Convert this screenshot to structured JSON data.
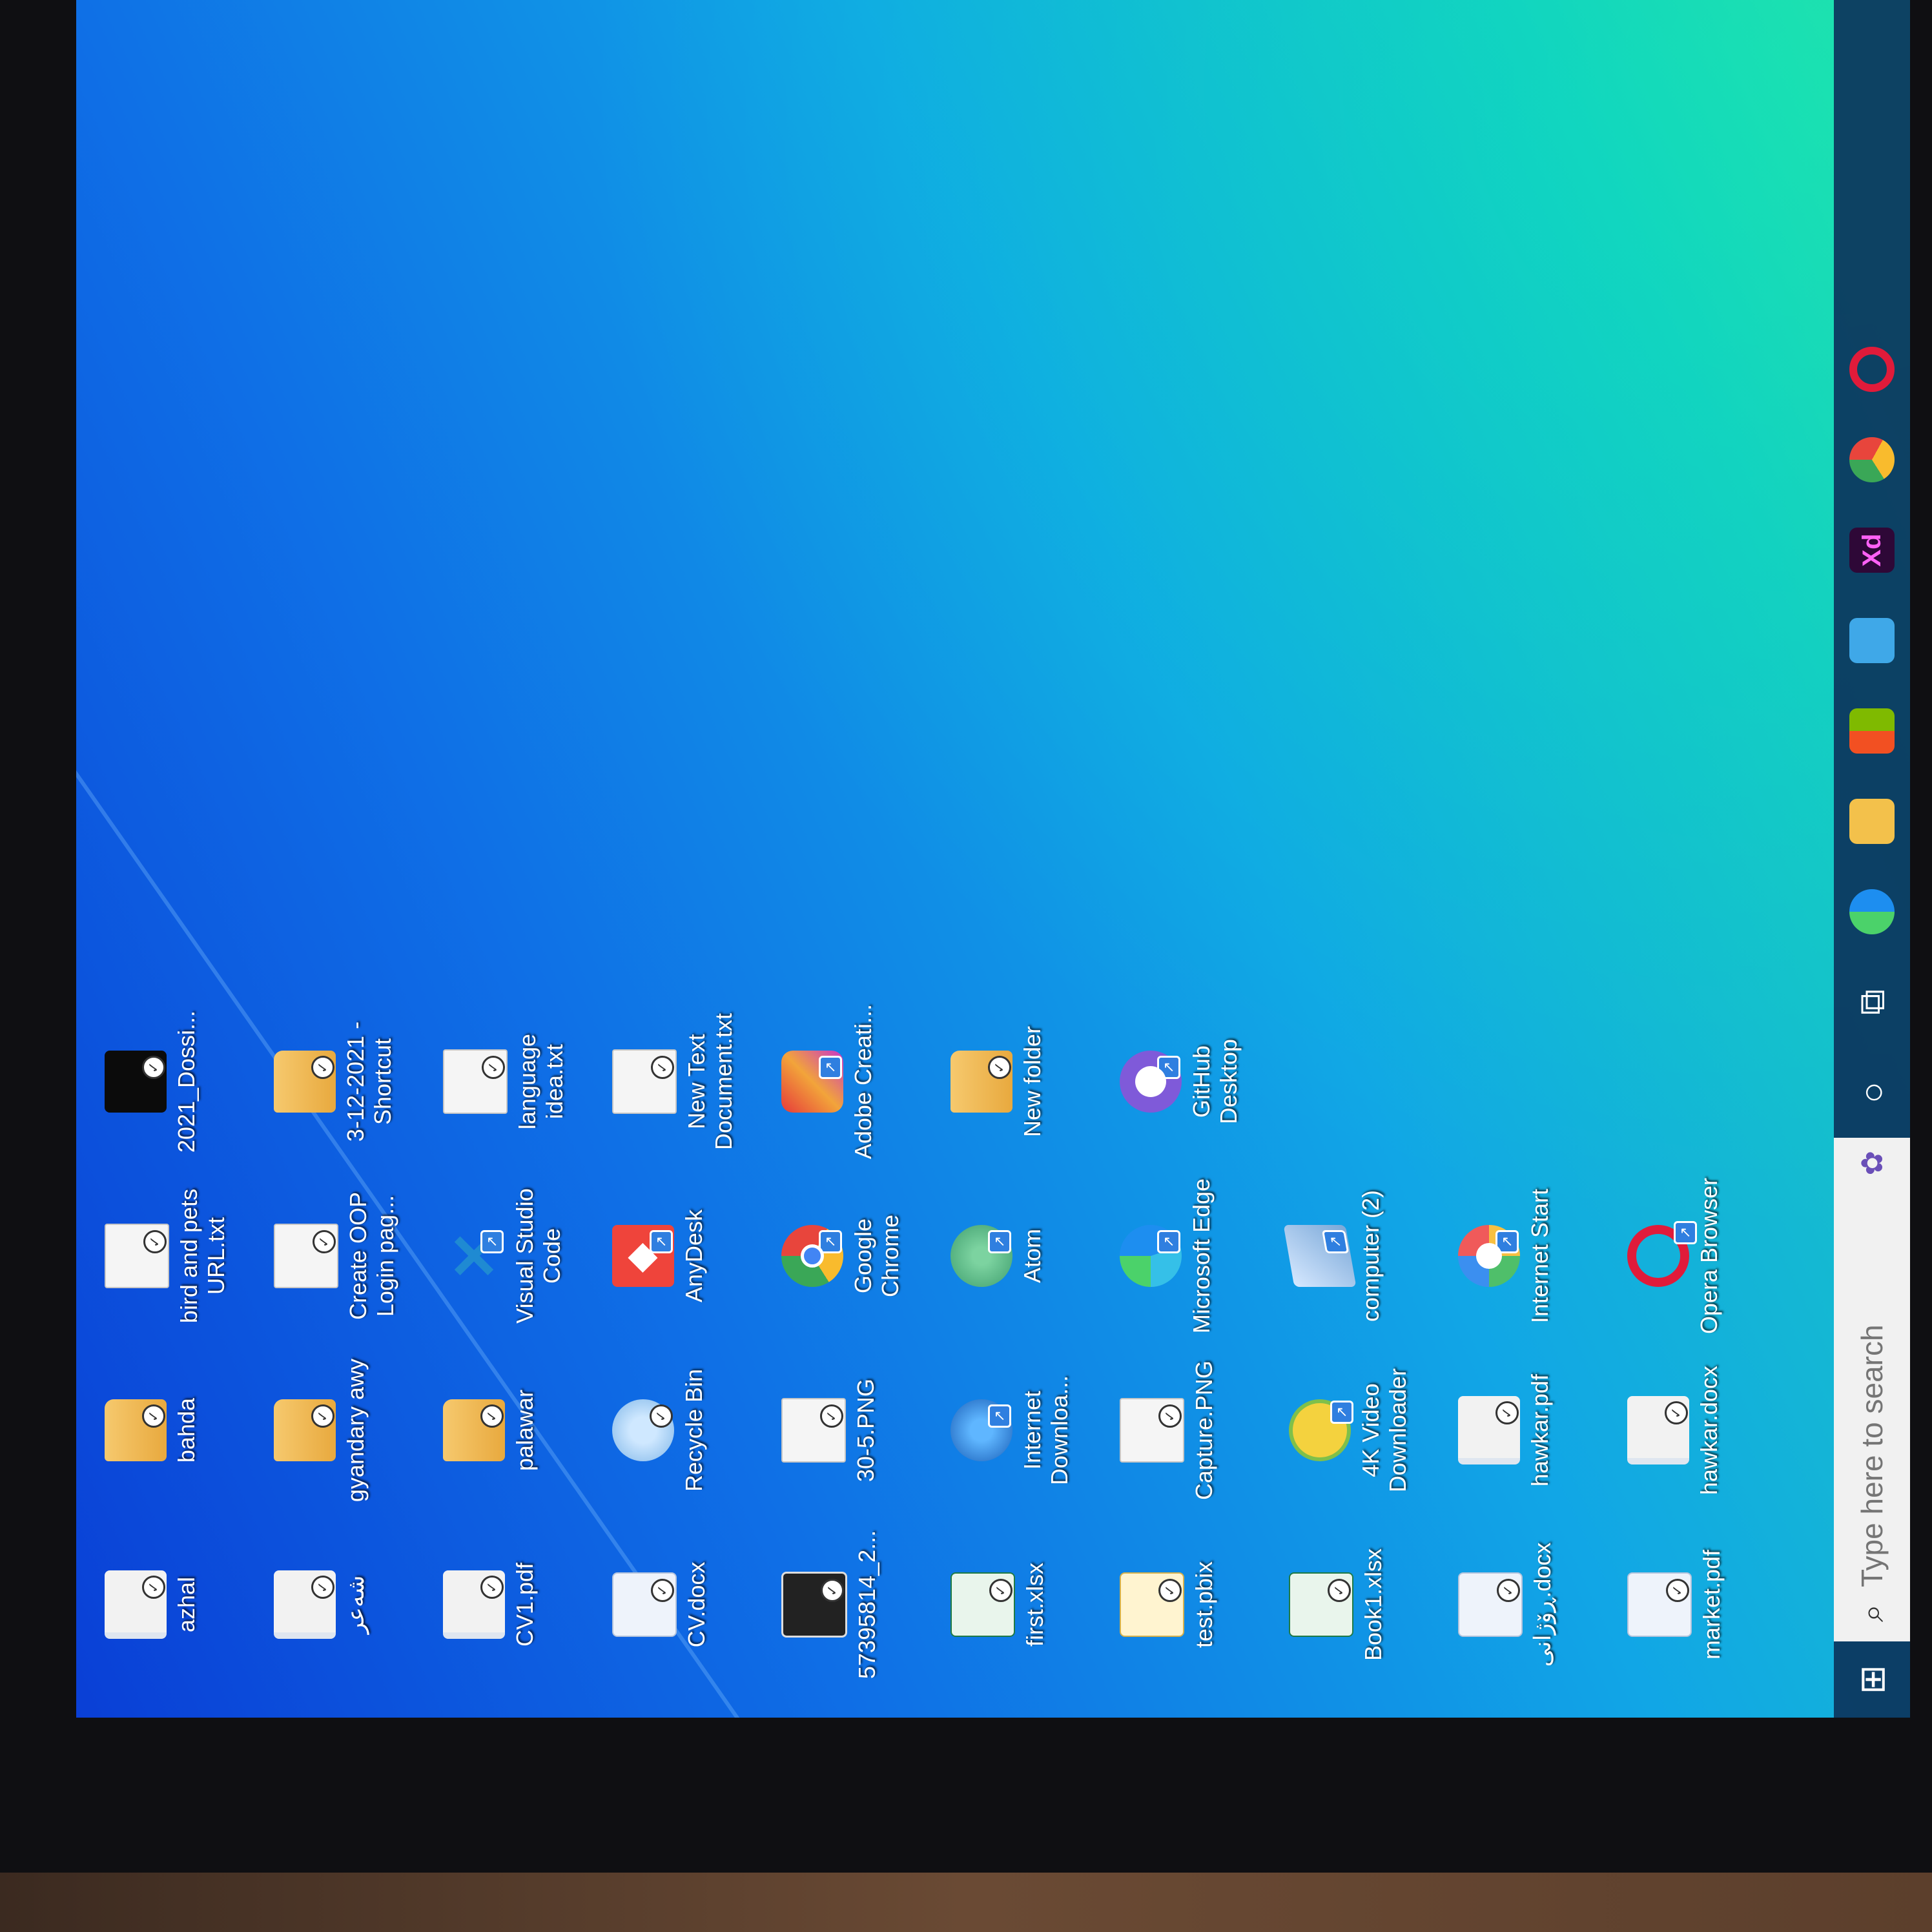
{
  "desktop": {
    "icons": [
      {
        "label": "azhal",
        "icon": "shortcut-icon",
        "type": "pdf"
      },
      {
        "label": "شەعر",
        "icon": "shortcut-icon",
        "type": "pdf"
      },
      {
        "label": "CV1.pdf",
        "icon": "pdf-file-icon",
        "type": "pdf"
      },
      {
        "label": "CV.docx",
        "icon": "word-doc-icon",
        "type": "doc"
      },
      {
        "label": "57395814_2...",
        "icon": "image-file-icon",
        "type": "img"
      },
      {
        "label": "first.xlsx",
        "icon": "excel-file-icon",
        "type": "xls"
      },
      {
        "label": "test.pbix",
        "icon": "powerbi-file-icon",
        "type": "pbix"
      },
      {
        "label": "Book1.xlsx",
        "icon": "excel-file-icon",
        "type": "xls"
      },
      {
        "label": "ڕۆژانی.docx",
        "icon": "word-doc-icon",
        "type": "doc"
      },
      {
        "label": "market.pdf",
        "icon": "pdf-file-icon",
        "type": "doc"
      },
      {
        "label": "bahda",
        "icon": "folder-icon",
        "type": "folder"
      },
      {
        "label": "gyandary awy",
        "icon": "folder-icon",
        "type": "folder"
      },
      {
        "label": "palawar",
        "icon": "folder-icon",
        "type": "folder"
      },
      {
        "label": "Recycle Bin",
        "icon": "recycle-bin-icon",
        "type": "recycle"
      },
      {
        "label": "30-5.PNG",
        "icon": "png-file-icon",
        "type": "file"
      },
      {
        "label": "Internet Downloa...",
        "icon": "idm-icon",
        "type": "idm"
      },
      {
        "label": "Capture.PNG",
        "icon": "png-file-icon",
        "type": "file"
      },
      {
        "label": "4K Video Downloader",
        "icon": "4k-video-downloader-icon",
        "type": "4k"
      },
      {
        "label": "hawkar.pdf",
        "icon": "pdf-file-icon",
        "type": "pdf"
      },
      {
        "label": "hawkar.docx",
        "icon": "word-doc-icon",
        "type": "pdf"
      },
      {
        "label": "bird and pets URL.txt",
        "icon": "text-file-icon",
        "type": "file"
      },
      {
        "label": "Create OOP Login pag...",
        "icon": "text-file-icon",
        "type": "file"
      },
      {
        "label": "Visual Studio Code",
        "icon": "vscode-icon",
        "type": "vscode"
      },
      {
        "label": "AnyDesk",
        "icon": "anydesk-icon",
        "type": "anydesk"
      },
      {
        "label": "Google Chrome",
        "icon": "chrome-icon",
        "type": "chrome"
      },
      {
        "label": "Atom",
        "icon": "atom-icon",
        "type": "atom"
      },
      {
        "label": "Microsoft Edge",
        "icon": "edge-icon",
        "type": "edge"
      },
      {
        "label": "computer (2)",
        "icon": "computer-icon",
        "type": "pc"
      },
      {
        "label": "Internet Start",
        "icon": "internet-start-icon",
        "type": "istart"
      },
      {
        "label": "Opera Browser",
        "icon": "opera-icon",
        "type": "opera"
      },
      {
        "label": "2021_Dossi...",
        "icon": "black-file-icon",
        "type": "blackfile"
      },
      {
        "label": "3-12-2021 - Shortcut",
        "icon": "folder-shortcut-icon",
        "type": "folder"
      },
      {
        "label": "language idea.txt",
        "icon": "text-file-icon",
        "type": "file"
      },
      {
        "label": "New Text Document.txt",
        "icon": "text-file-icon",
        "type": "file"
      },
      {
        "label": "Adobe Creati...",
        "icon": "adobe-creative-cloud-icon",
        "type": "adobe"
      },
      {
        "label": "New folder",
        "icon": "folder-icon",
        "type": "folder"
      },
      {
        "label": "GitHub Desktop",
        "icon": "github-desktop-icon",
        "type": "github"
      },
      {
        "label": "",
        "icon": "",
        "type": "empty"
      },
      {
        "label": "",
        "icon": "",
        "type": "empty"
      },
      {
        "label": "",
        "icon": "",
        "type": "empty"
      }
    ]
  },
  "taskbar": {
    "search_placeholder": "Type here to search",
    "start_icon": "windows-start-icon",
    "apps": [
      {
        "name": "cortana-icon"
      },
      {
        "name": "task-view-icon"
      },
      {
        "name": "edge-icon",
        "color": "#1d8ef0"
      },
      {
        "name": "file-explorer-icon",
        "color": "#f3c14b"
      },
      {
        "name": "store-icon",
        "color": "#5ea0f0"
      },
      {
        "name": "mail-icon",
        "color": "#3fa8e8"
      },
      {
        "name": "xd-icon",
        "label": "Xd"
      },
      {
        "name": "chrome-icon"
      },
      {
        "name": "opera-icon"
      }
    ]
  },
  "colors": {
    "accent": "#0f6fe6",
    "taskbar": "#0c345c"
  }
}
